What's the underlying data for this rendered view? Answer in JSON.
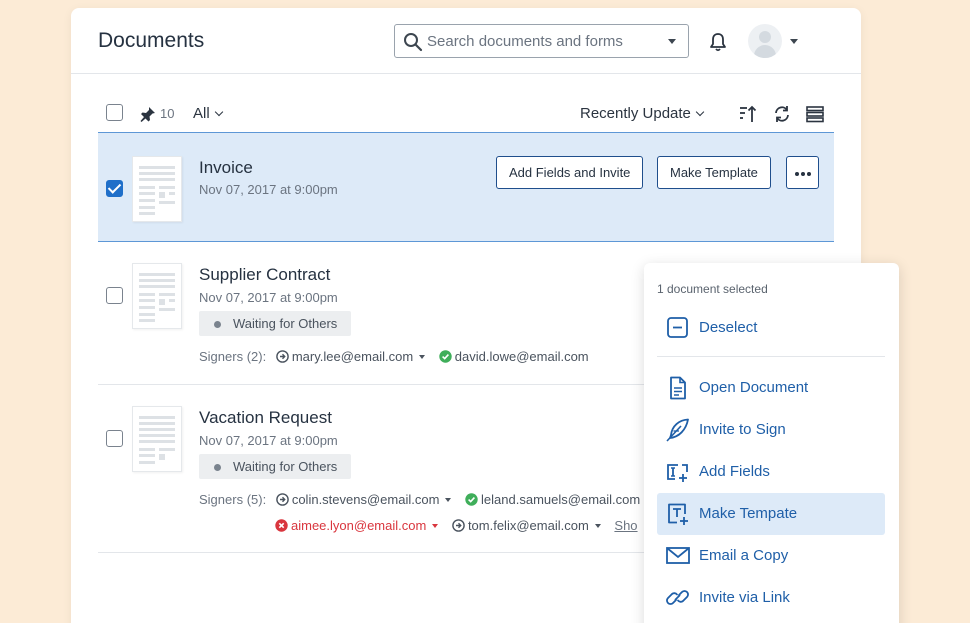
{
  "header": {
    "title": "Documents",
    "search_placeholder": "Search documents and forms"
  },
  "toolbar": {
    "pinned_count": "10",
    "filter_label": "All",
    "sort_label": "Recently Update"
  },
  "documents": [
    {
      "title": "Invoice",
      "date": "Nov 07, 2017 at 9:00pm",
      "selected": true,
      "actions": [
        "Add Fields and Invite",
        "Make Template"
      ]
    },
    {
      "title": "Supplier Contract",
      "date": "Nov 07, 2017 at 9:00pm",
      "status": "Waiting for Others",
      "signers_label": "Signers (2):",
      "signers": [
        {
          "email": "mary.lee@email.com",
          "state": "pending"
        },
        {
          "email": "david.lowe@email.com",
          "state": "signed"
        }
      ]
    },
    {
      "title": "Vacation Request",
      "date": "Nov 07, 2017 at 9:00pm",
      "status": "Waiting for Others",
      "signers_label": "Signers (5):",
      "signers": [
        {
          "email": "colin.stevens@email.com",
          "state": "pending"
        },
        {
          "email": "leland.samuels@email.com",
          "state": "signed"
        },
        {
          "email": "aimee.lyon@email.com",
          "state": "declined"
        },
        {
          "email": "tom.felix@email.com",
          "state": "pending"
        }
      ],
      "more_label": "Sho"
    }
  ],
  "context_menu": {
    "header": "1 document selected",
    "items": [
      {
        "label": "Deselect",
        "icon": "minus-square-icon"
      },
      {
        "label": "Open Document",
        "icon": "document-icon"
      },
      {
        "label": "Invite to Sign",
        "icon": "feather-icon"
      },
      {
        "label": "Add Fields",
        "icon": "text-field-plus-icon"
      },
      {
        "label": "Make Tempate",
        "icon": "template-icon",
        "highlighted": true
      },
      {
        "label": "Email a Copy",
        "icon": "envelope-icon"
      },
      {
        "label": "Invite via Link",
        "icon": "link-icon"
      }
    ]
  },
  "colors": {
    "background": "#fcebd6",
    "accent": "#1f6fc9",
    "selected_row": "#ddeaf8",
    "signed": "#3fae5a",
    "declined": "#d9363e"
  }
}
